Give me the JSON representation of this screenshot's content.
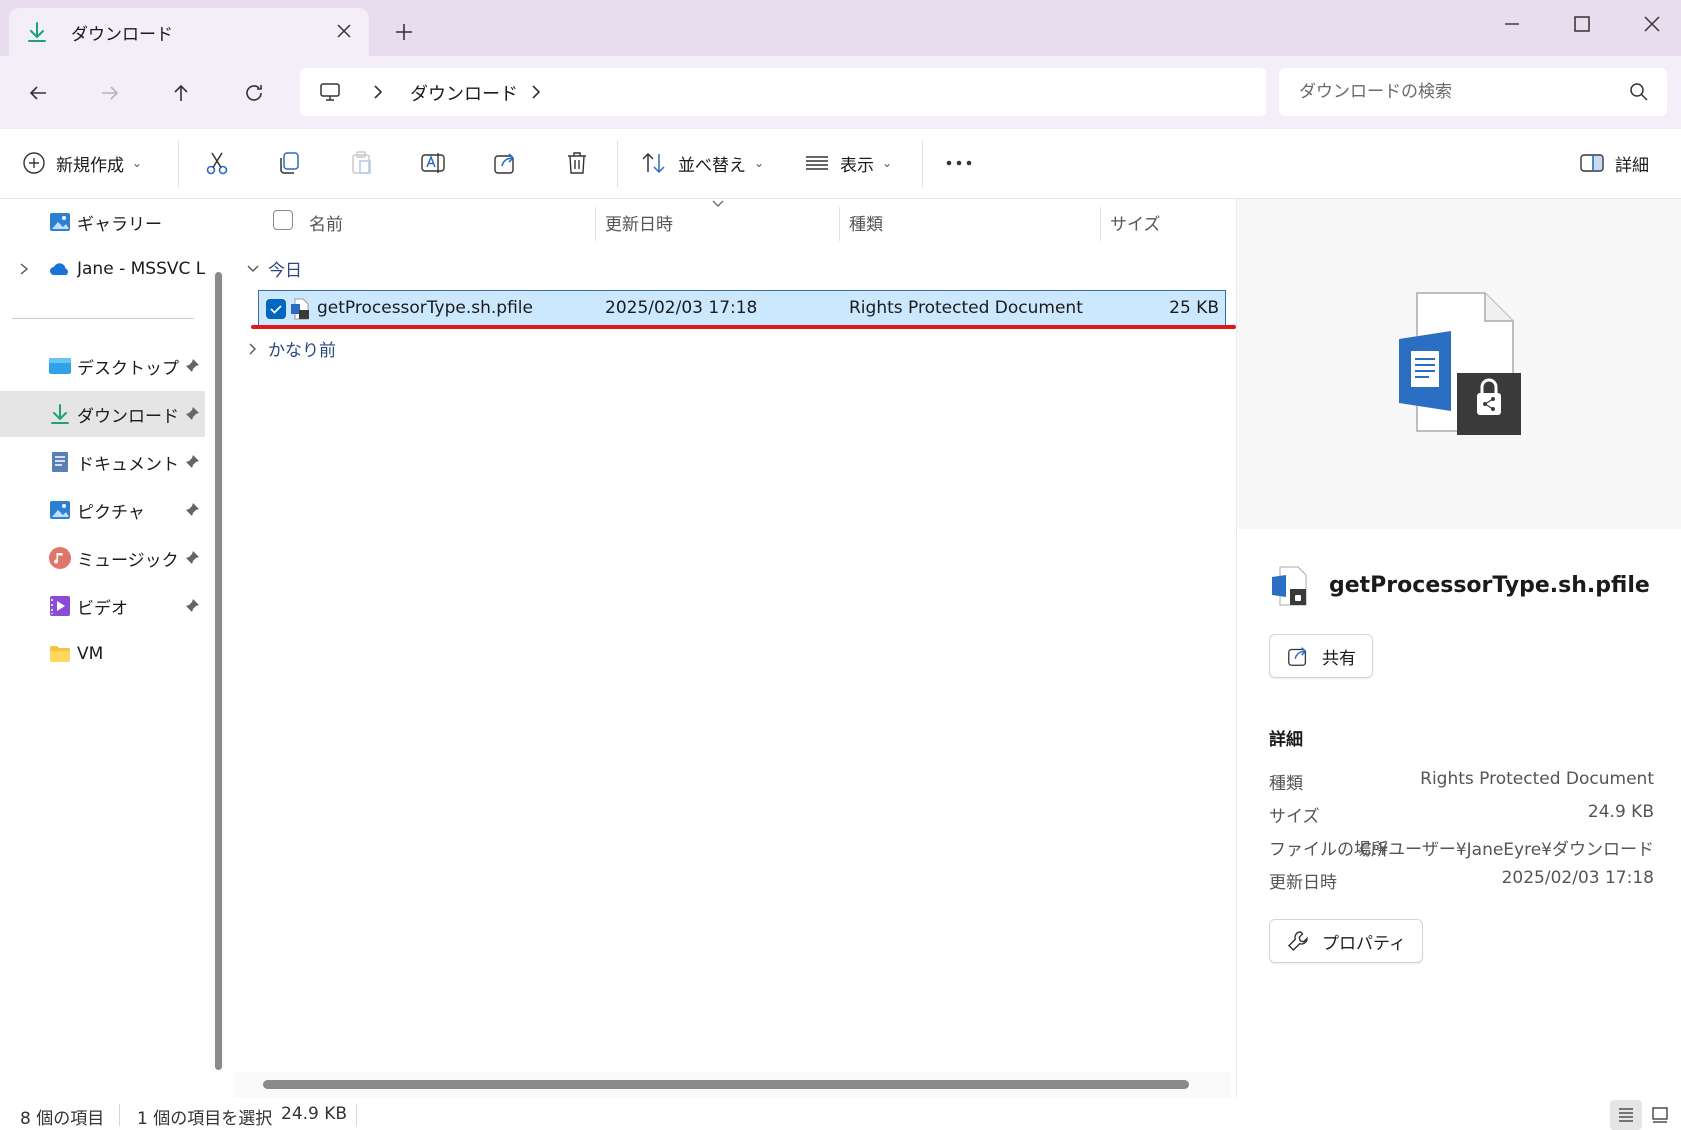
{
  "tab": {
    "title": "ダウンロード"
  },
  "address": {
    "crumb": "ダウンロード",
    "search_placeholder": "ダウンロードの検索"
  },
  "toolbar": {
    "new_label": "新規作成",
    "sort_label": "並べ替え",
    "view_label": "表示",
    "details_label": "詳細"
  },
  "sidebar": {
    "items": [
      {
        "label": "ギャラリー"
      },
      {
        "label": "Jane - MSSVC La"
      },
      {
        "label": "デスクトップ"
      },
      {
        "label": "ダウンロード"
      },
      {
        "label": "ドキュメント"
      },
      {
        "label": "ピクチャ"
      },
      {
        "label": "ミュージック"
      },
      {
        "label": "ビデオ"
      },
      {
        "label": "VM"
      }
    ]
  },
  "columns": {
    "name": "名前",
    "modified": "更新日時",
    "type": "種類",
    "size": "サイズ"
  },
  "groups": {
    "today": "今日",
    "long_ago": "かなり前"
  },
  "file": {
    "name": "getProcessorType.sh.pfile",
    "modified": "2025/02/03 17:18",
    "type": "Rights Protected Document",
    "size": "25 KB"
  },
  "details": {
    "file_name": "getProcessorType.sh.pfile",
    "share_label": "共有",
    "heading": "詳細",
    "props": [
      {
        "key": "種類",
        "value": "Rights Protected Document"
      },
      {
        "key": "サイズ",
        "value": "24.9 KB"
      },
      {
        "key": "ファイルの場所",
        "value": "C:¥ユーザー¥JaneEyre¥ダウンロード"
      },
      {
        "key": "更新日時",
        "value": "2025/02/03 17:18"
      }
    ],
    "properties_label": "プロパティ"
  },
  "status": {
    "count": "8 個の項目",
    "selected": "1 個の項目を選択",
    "selected_size": "24.9 KB"
  },
  "colors": {
    "accent": "#0067c0",
    "selection": "#cce8ff",
    "highlight": "#e01818",
    "onedrive": "#1a73d9"
  }
}
